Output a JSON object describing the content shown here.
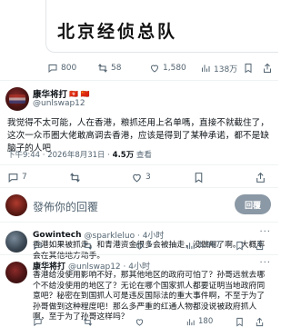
{
  "quoted": {
    "image_text": "北京经侦总队"
  },
  "top_actions": {
    "replies": "800",
    "reposts": "58",
    "likes": "1,580",
    "views": "138万"
  },
  "tweet": {
    "author_name": "康华将打",
    "author_badges": "🇭🇰 🇨🇳",
    "author_handle": "@unlswap12",
    "text": "我觉得不太可能，人在香港，粮抓还用上名单嗎，直接不就截住了，这次一众币圈大佬敢高调去香港，应该是得到了某种承诺，都不是缺脑子的人吧",
    "time": "下午9:44 · 2026年8月31日 · ",
    "views_count": "4.5万",
    "views_label": " 查看",
    "stats": {
      "replies": "7",
      "reposts": "",
      "likes": "3",
      "bookmarks": ""
    }
  },
  "composer": {
    "placeholder": "發佈你的回覆",
    "reply_label": "回覆"
  },
  "replies": [
    {
      "name": "Gowintech",
      "handle": "@sparkleluo · 4小时",
      "text": "香港如果被抓走，和青港资金很多会被抽走，没做用了啊。大概率会在其他地方动手。",
      "replies": "",
      "reposts": "",
      "likes": "1",
      "views": "1,967"
    },
    {
      "name": "康华将打",
      "handle": "@unlswap12 · 4小时",
      "text": "香港给没使用影响不好，那其他地区的政府可怕了？孙哥远就去哪个不给没使用的地区了？无论在哪个国家抓人都要证明当地政府同意吧？秘密在到国抓人可是违反国际法的重大事件啊，不至于为了孙哥做到这种程度吧！那么多严重的红通人物都没说被政府抓人啊，至于为了孙哥这样吗？",
      "replies": "",
      "reposts": "",
      "likes": "",
      "views": "180"
    }
  ],
  "colors": {
    "text": "#0f1419",
    "muted": "#536471",
    "divider": "#eff3f4",
    "reply_button": "#8b98a5"
  }
}
